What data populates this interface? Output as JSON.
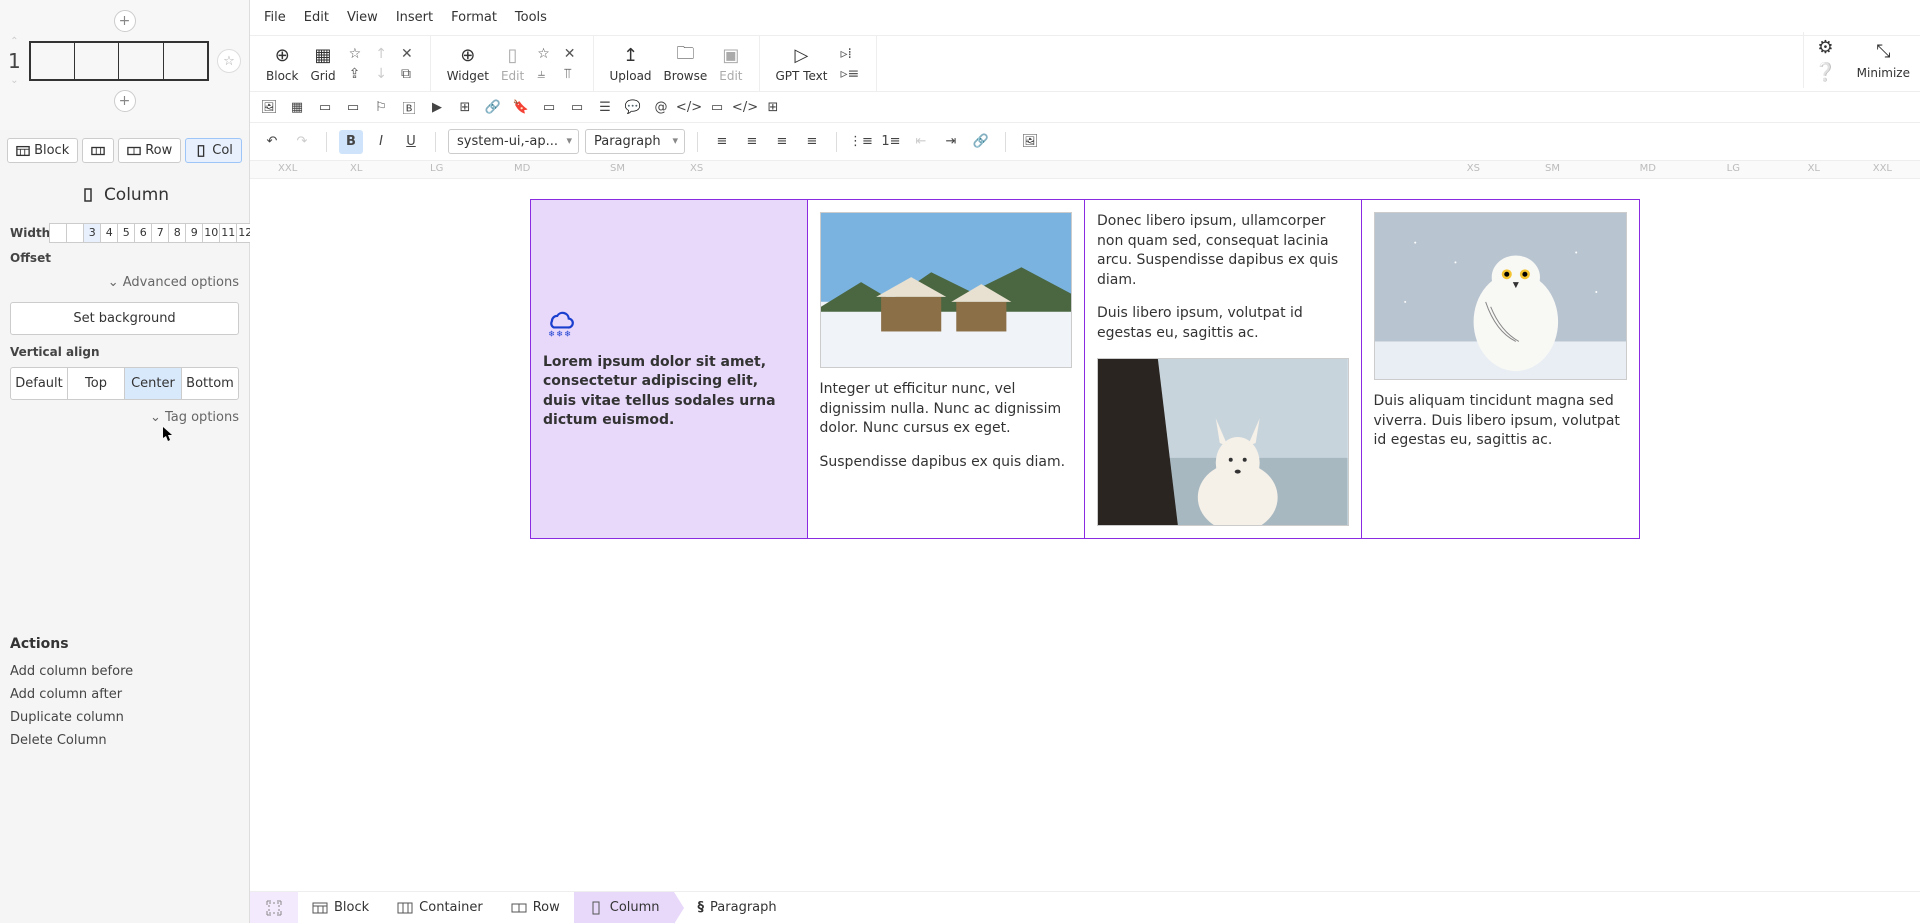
{
  "leftPanel": {
    "blockIndex": "1",
    "scopeTabs": {
      "block": "Block",
      "row": "Row",
      "col": "Col"
    },
    "sectionTitle": "Column",
    "widthLabel": "Width",
    "widthCells": [
      "",
      "",
      "3",
      "4",
      "5",
      "6",
      "7",
      "8",
      "9",
      "10",
      "11",
      "12"
    ],
    "widthActive": "3",
    "offsetLabel": "Offset",
    "advancedOptions": "Advanced options",
    "setBackground": "Set background",
    "verticalAlignLabel": "Vertical align",
    "valign": {
      "default": "Default",
      "top": "Top",
      "center": "Center",
      "bottom": "Bottom"
    },
    "tagOptions": "Tag options",
    "actionsTitle": "Actions",
    "actions": {
      "addBefore": "Add column before",
      "addAfter": "Add column after",
      "duplicate": "Duplicate column",
      "delete": "Delete Column"
    }
  },
  "menuBar": [
    "File",
    "Edit",
    "View",
    "Insert",
    "Format",
    "Tools"
  ],
  "toolbar1": {
    "block": "Block",
    "grid": "Grid",
    "widget": "Widget",
    "edit": "Edit",
    "upload": "Upload",
    "browse": "Browse",
    "gptText": "GPT Text",
    "minimize": "Minimize"
  },
  "toolbar3": {
    "fontSelect": "system-ui,-ap...",
    "styleSelect": "Paragraph"
  },
  "ruler": [
    "XXL",
    "XL",
    "LG",
    "MD",
    "SM",
    "XS",
    "XS",
    "SM",
    "MD",
    "LG",
    "XL",
    "XXL"
  ],
  "canvas": {
    "col1": {
      "text": "Lorem ipsum dolor sit amet, consectetur adipiscing elit, duis vitae tellus sodales urna dictum euismod."
    },
    "col2": {
      "p1": "Integer ut efficitur nunc, vel dignissim nulla. Nunc ac dignissim dolor. Nunc cursus ex eget.",
      "p2": "Suspendisse dapibus ex quis diam."
    },
    "col3": {
      "p1": "Donec libero ipsum, ullamcorper non quam sed, consequat lacinia arcu. Suspendisse dapibus ex quis diam.",
      "p2": "Duis libero ipsum, volutpat id egestas eu, sagittis ac."
    },
    "col4": {
      "p1": "Duis aliquam tincidunt magna sed viverra. Duis libero ipsum, volutpat id egestas eu, sagittis ac."
    }
  },
  "breadcrumb": {
    "block": "Block",
    "container": "Container",
    "row": "Row",
    "column": "Column",
    "paragraph": "Paragraph"
  }
}
